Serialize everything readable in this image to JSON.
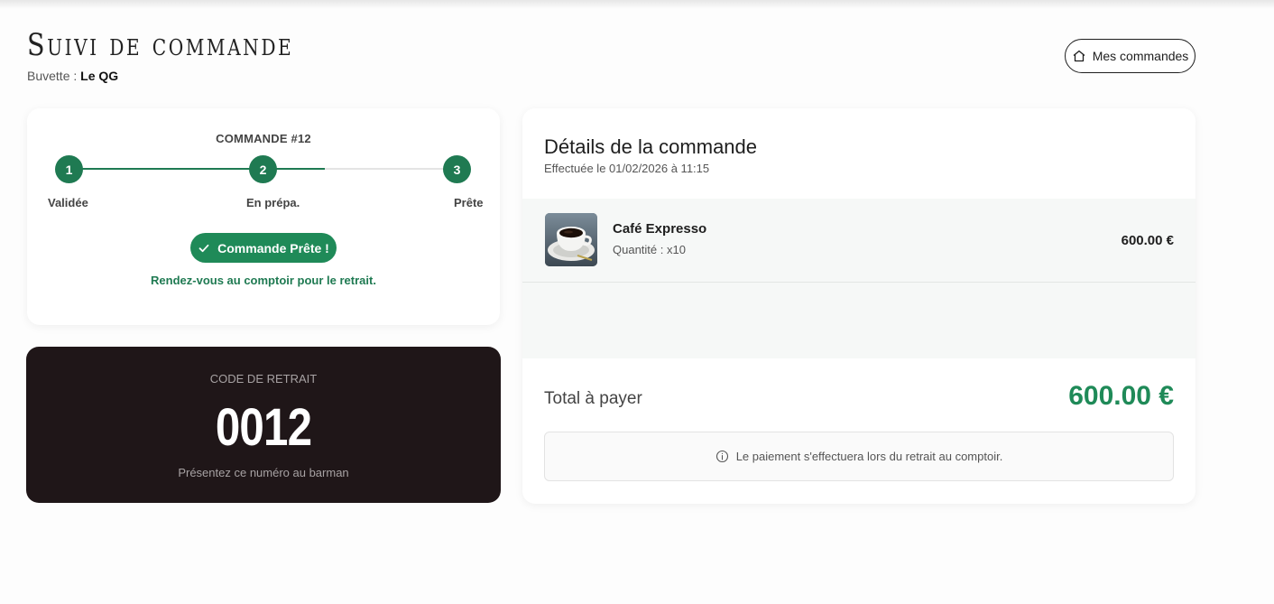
{
  "header": {
    "title": "Suivi de commande",
    "buvette_label": "Buvette : ",
    "buvette_name": "Le QG",
    "my_orders_label": "Mes commandes",
    "my_orders_icon": "home-icon"
  },
  "status": {
    "order_number": "COMMANDE #12",
    "steps": [
      {
        "number": "1",
        "label": "Validée"
      },
      {
        "number": "2",
        "label": "En prépa."
      },
      {
        "number": "3",
        "label": "Prête"
      }
    ],
    "progress_fraction": 0.66,
    "ready_label": "Commande Prête !",
    "ready_icon": "check-icon",
    "ready_message": "Rendez-vous au comptoir pour le retrait.",
    "accent_color": "#1f7a52"
  },
  "pickup": {
    "label": "CODE DE RETRAIT",
    "code": "0012",
    "hint": "Présentez ce numéro au barman",
    "background_color": "#1f1618"
  },
  "details": {
    "title": "Détails de la commande",
    "date": "Effectuée le 01/02/2026 à 11:15",
    "items": [
      {
        "name": "Café Expresso",
        "quantity": "Quantité : x10",
        "price": "600.00 €",
        "image": "coffee-cup-image"
      }
    ],
    "total_label": "Total à payer",
    "total_value": "600.00 €",
    "payment_note": "Le paiement s'effectuera lors du retrait au comptoir.",
    "payment_icon": "info-icon"
  }
}
